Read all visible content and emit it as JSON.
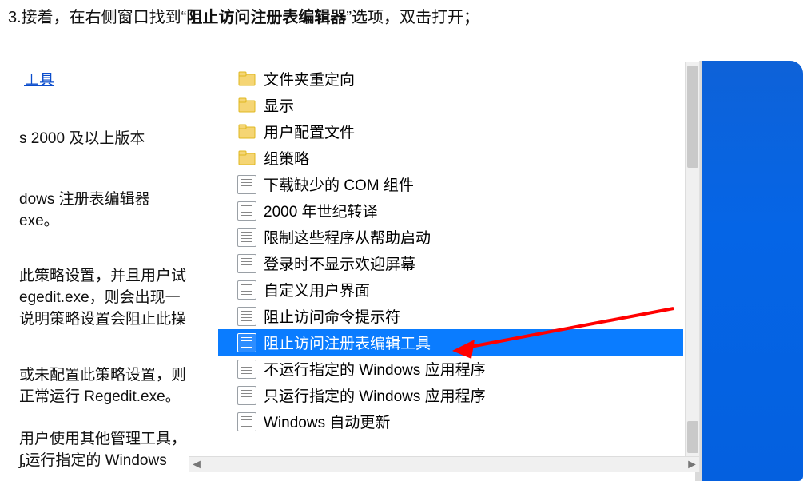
{
  "instruction": {
    "prefix": "3.接着，在右侧窗口找到“",
    "bold": "阻止访问注册表编辑器",
    "suffix": "”选项，双击打开；"
  },
  "left_fragments": {
    "link": "⊥具",
    "a": "s 2000 及以上版本",
    "b": "dows 注册表编辑器",
    "bb": "exe。",
    "c": "此策略设置，并且用户试",
    "c2": "egedit.exe，则会出现一",
    "c3": "说明策略设置会阻止此操",
    "d": "或未配置此策略设置，则",
    "d2": "正常运行 Regedit.exe。",
    "e": "用户使用其他管理工具，",
    "e2": "ᶋ运行指定的 Windows"
  },
  "list_items": [
    {
      "kind": "folder",
      "label": "文件夹重定向"
    },
    {
      "kind": "folder",
      "label": "显示"
    },
    {
      "kind": "folder",
      "label": "用户配置文件"
    },
    {
      "kind": "folder",
      "label": "组策略"
    },
    {
      "kind": "set",
      "label": "下载缺少的 COM 组件"
    },
    {
      "kind": "set",
      "label": "2000 年世纪转译"
    },
    {
      "kind": "set",
      "label": "限制这些程序从帮助启动"
    },
    {
      "kind": "set",
      "label": "登录时不显示欢迎屏幕"
    },
    {
      "kind": "set",
      "label": "自定义用户界面"
    },
    {
      "kind": "set",
      "label": "阻止访问命令提示符"
    },
    {
      "kind": "set",
      "label": "阻止访问注册表编辑工具",
      "selected": true
    },
    {
      "kind": "set",
      "label": "不运行指定的 Windows 应用程序"
    },
    {
      "kind": "set",
      "label": "只运行指定的 Windows 应用程序"
    },
    {
      "kind": "set",
      "label": "Windows 自动更新"
    }
  ],
  "scrollbar": {
    "h_arrows": [
      "◄",
      "►"
    ]
  }
}
